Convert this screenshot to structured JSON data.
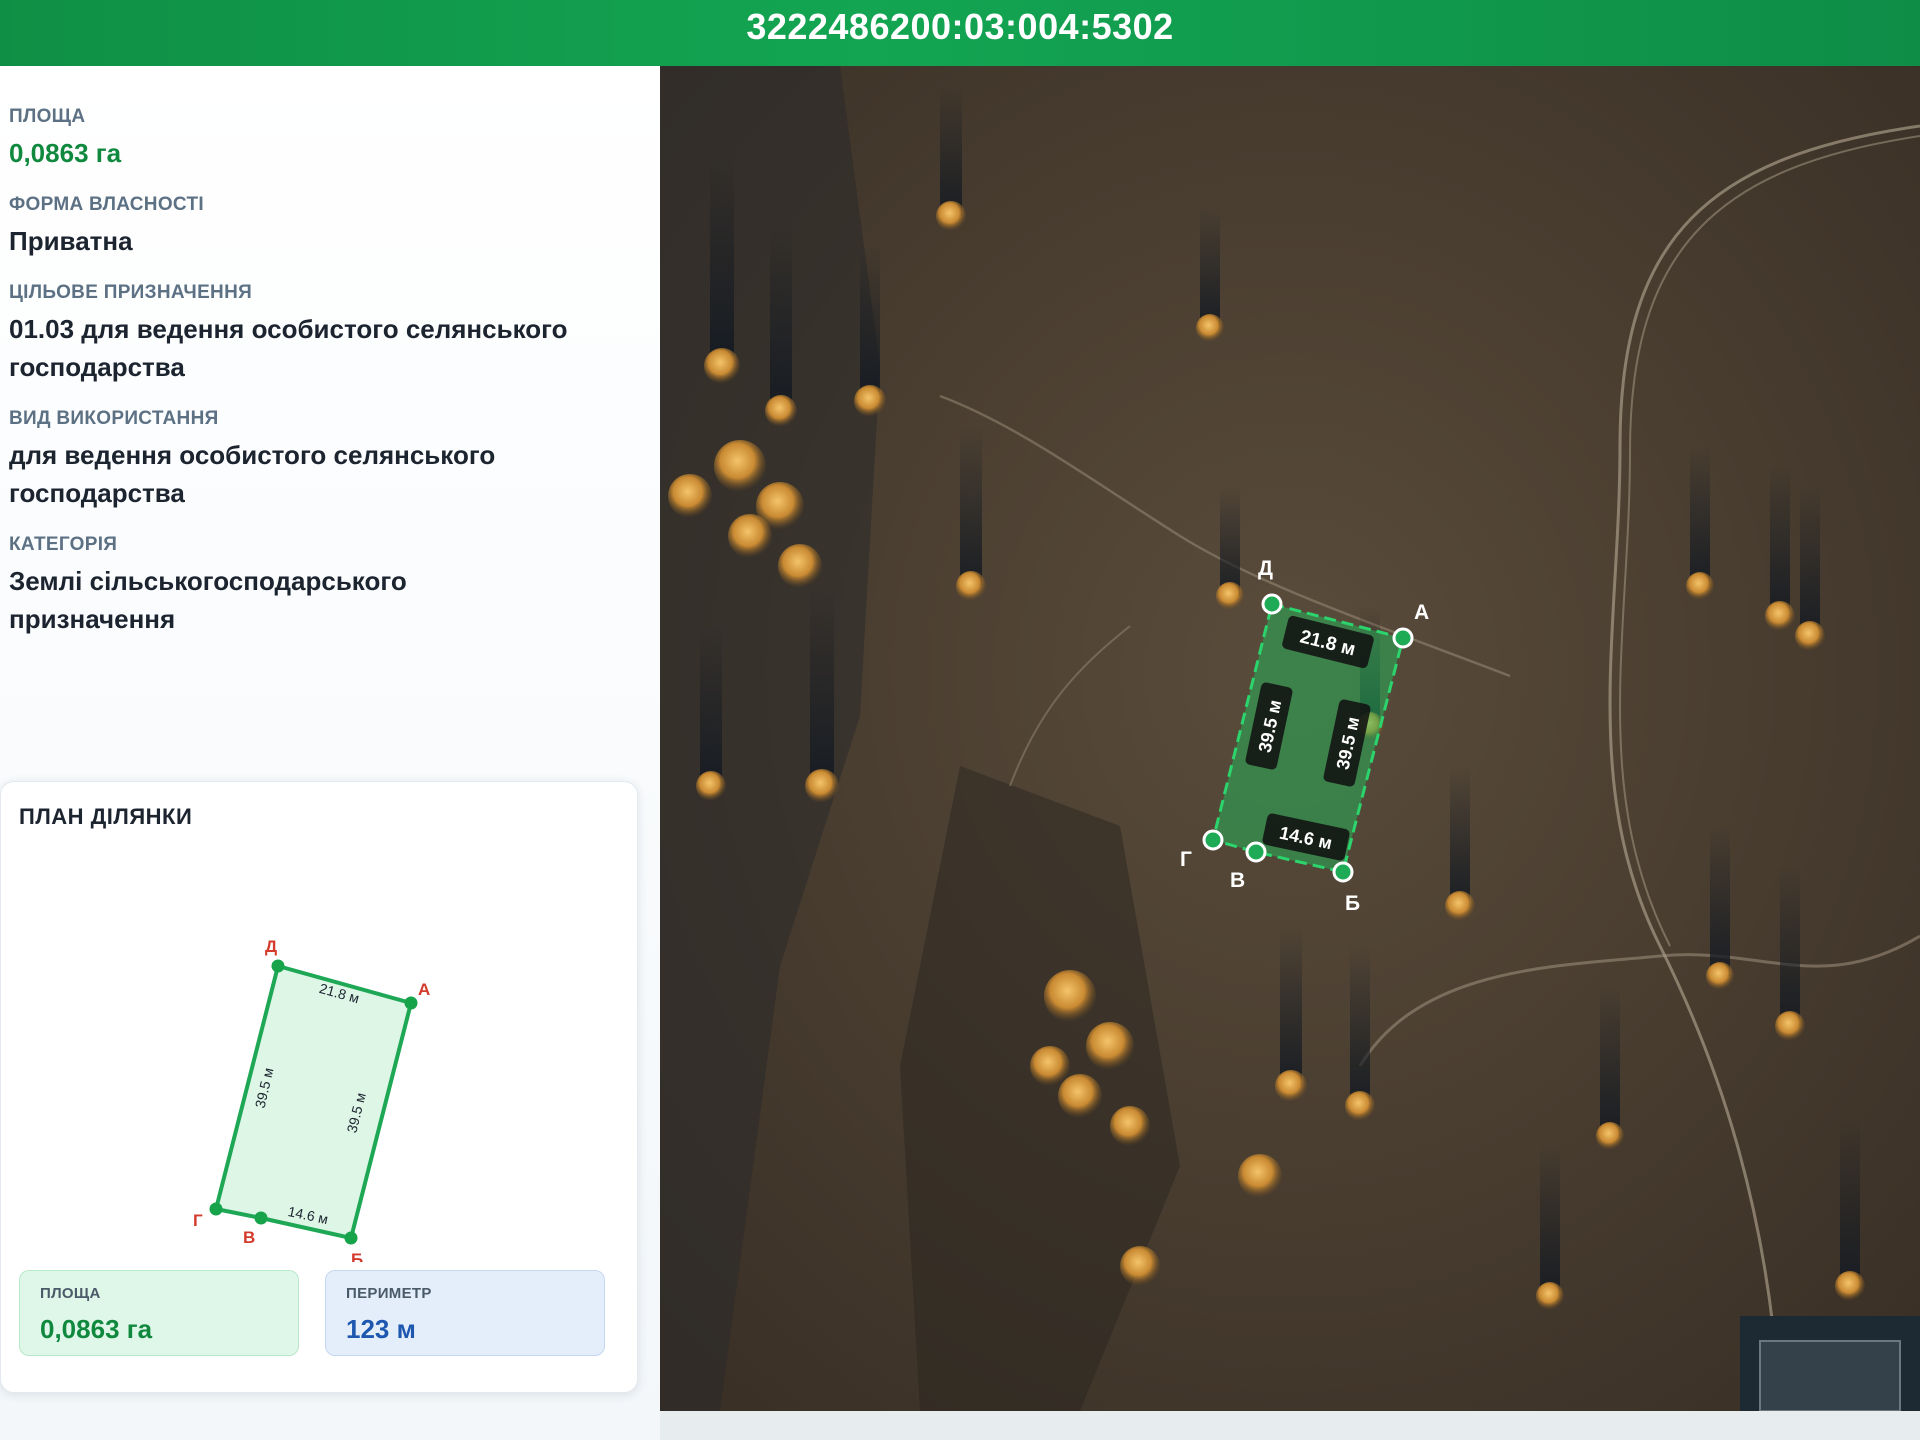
{
  "header": {
    "cadastral_number": "3222486200:03:004:5302"
  },
  "parcel_info": {
    "area": {
      "label": "ПЛОЩА",
      "value": "0,0863 га"
    },
    "ownership": {
      "label": "ФОРМА ВЛАСНОСТІ",
      "value": "Приватна"
    },
    "purpose": {
      "label": "ЦІЛЬОВЕ ПРИЗНАЧЕННЯ",
      "value_line1": "01.03 для ведення особистого селянського",
      "value_line2": "господарства"
    },
    "usage": {
      "label": "ВИД ВИКОРИСТАННЯ",
      "value_line1": "для ведення особистого селянського",
      "value_line2": "господарства"
    },
    "category": {
      "label": "КАТЕГОРІЯ",
      "value_line1": "Землі сільськогосподарського",
      "value_line2": "призначення"
    }
  },
  "plan": {
    "title": "ПЛАН ДІЛЯНКИ",
    "vertices": {
      "d": "Д",
      "a": "А",
      "b": "Б",
      "v": "В",
      "g": "Г"
    },
    "sides": {
      "top": "21.8 м",
      "left": "39.5 м",
      "right": "39.5 м",
      "bottom": "14.6 м"
    },
    "area_stat": {
      "label": "ПЛОЩА",
      "value": "0,0863 га"
    },
    "perimeter_stat": {
      "label": "ПЕРИМЕТР",
      "value": "123 м"
    }
  },
  "map_overlay": {
    "vertices": {
      "d": "Д",
      "a": "А",
      "b": "Б",
      "v": "В",
      "g": "Г"
    },
    "sides": {
      "top": "21.8 м",
      "left": "39.5 м",
      "right": "39.5 м",
      "bottom": "14.6 м"
    }
  },
  "colors": {
    "brand_green": "#13a552",
    "parcel_green": "#1fb55a",
    "vertex_red": "#d43b2c",
    "perimeter_blue": "#1d57b0"
  }
}
